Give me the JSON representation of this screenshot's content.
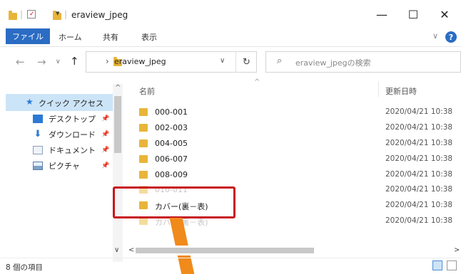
{
  "titlebar": {
    "separator": "|",
    "dropdown": "▾",
    "title": "eraview_jpeg",
    "minimize": "—",
    "maximize": "☐",
    "close": "✕"
  },
  "ribbon": {
    "file_tab": "ファイル",
    "tabs": [
      "ホーム",
      "共有",
      "表示"
    ],
    "expand": "∨",
    "help": "?"
  },
  "address": {
    "back": "←",
    "forward": "→",
    "recent": "∨",
    "up": "↑",
    "chevron": "›",
    "path": "eraview_jpeg",
    "dropdown": "∨",
    "refresh": "↻",
    "search_icon": "⌕",
    "search_placeholder": "eraview_jpegの検索"
  },
  "navpane": {
    "quick_access": "クイック アクセス",
    "items": [
      {
        "label": "デスクトップ",
        "icon": "desktop-icon",
        "color": "#2b79d6"
      },
      {
        "label": "ダウンロード",
        "icon": "download-icon",
        "color": "#2b79d6"
      },
      {
        "label": "ドキュメント",
        "icon": "document-icon",
        "color": "#8aa0b8"
      },
      {
        "label": "ピクチャ",
        "icon": "picture-icon",
        "color": "#5a7fa8"
      }
    ],
    "pin": "📌"
  },
  "columns": {
    "name": "名前",
    "modified": "更新日時",
    "sort_indicator": "^"
  },
  "files": [
    {
      "name": "000-001",
      "date": "2020/04/21 10:38"
    },
    {
      "name": "002-003",
      "date": "2020/04/21 10:38"
    },
    {
      "name": "004-005",
      "date": "2020/04/21 10:38"
    },
    {
      "name": "006-007",
      "date": "2020/04/21 10:38"
    },
    {
      "name": "008-009",
      "date": "2020/04/21 10:38"
    },
    {
      "name": "010-011",
      "date": "2020/04/21 10:38"
    },
    {
      "name": "カバー(裏－表)",
      "date": "2020/04/21 10:38"
    },
    {
      "name": "カバー(裏－表)",
      "date": "2020/04/21 10:38"
    }
  ],
  "status": {
    "count": "8 個の項目"
  },
  "scroll": {
    "up": "^",
    "down": "∨",
    "left": "<",
    "right": ">"
  },
  "colors": {
    "accent": "#2b6cc4",
    "highlight": "#c8161d",
    "arrow": "#f08a1a",
    "folder": "#e8b53a"
  }
}
